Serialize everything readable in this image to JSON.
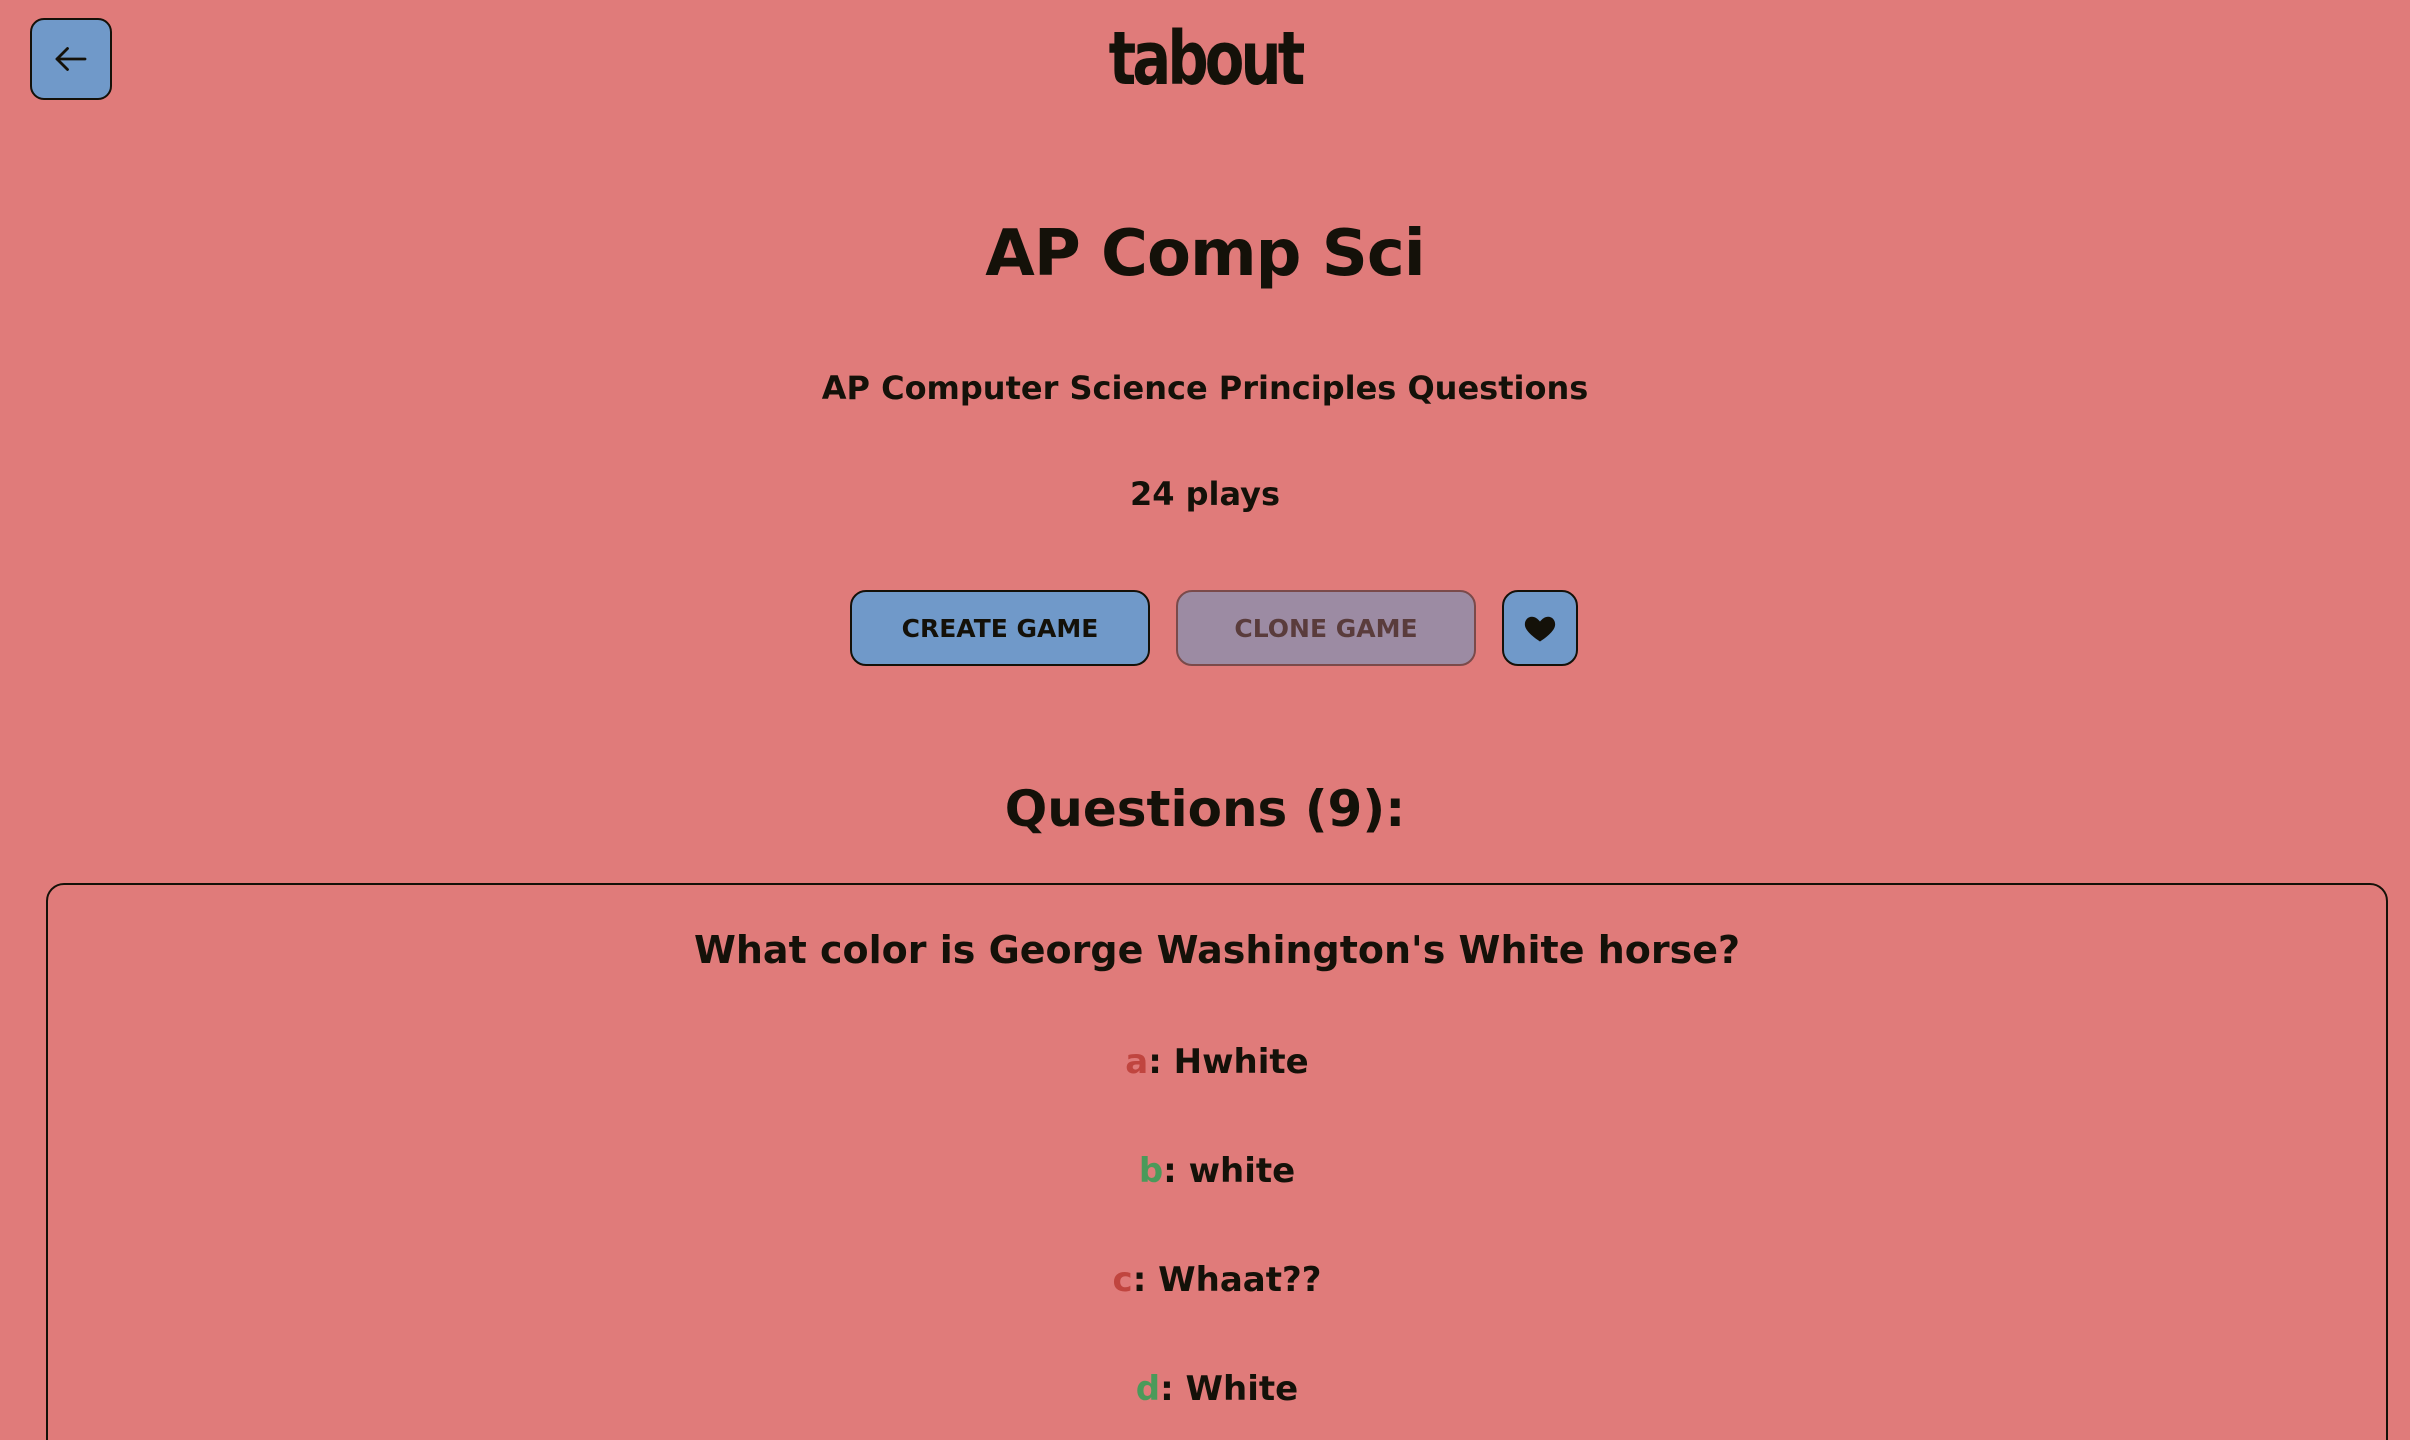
{
  "header": {
    "logo_text": "tabout",
    "back_icon": "arrow-left-icon"
  },
  "set": {
    "title": "AP Comp Sci",
    "description": "AP Computer Science Principles Questions",
    "plays": "24 plays"
  },
  "actions": {
    "create_label": "CREATE GAME",
    "clone_label": "CLONE GAME",
    "favorite_icon": "heart-icon"
  },
  "questions_section": {
    "heading": "Questions (9):"
  },
  "questions": [
    {
      "text": "What color is George Washington's White horse?",
      "answers": [
        {
          "letter": "a",
          "text": ": Hwhite",
          "correct": false
        },
        {
          "letter": "b",
          "text": ": white",
          "correct": true
        },
        {
          "letter": "c",
          "text": ": Whaat??",
          "correct": false
        },
        {
          "letter": "d",
          "text": ": White",
          "correct": true
        }
      ]
    }
  ],
  "colors": {
    "background": "#e07b7a",
    "primary_button": "#7099c9",
    "disabled_button": "#9c8ba3",
    "wrong_letter": "#c0453f",
    "correct_letter": "#4a9a5a",
    "text": "#141109"
  }
}
